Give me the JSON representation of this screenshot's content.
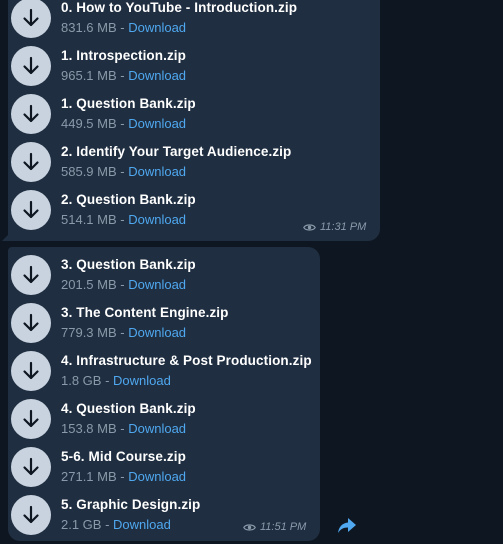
{
  "colors": {
    "background": "#0e1621",
    "bubble": "#1f2e40",
    "download_link": "#4fa8f0",
    "file_name": "#ffffff",
    "meta_text": "#8a9aaa",
    "icon_circle": "#c9d3df"
  },
  "messages": [
    {
      "files": [
        {
          "name": "0. How to YouTube - Introduction.zip",
          "size": "831.6 MB",
          "separator": " - ",
          "action": "Download",
          "icon": "download-arrow-icon"
        },
        {
          "name": "1. Introspection.zip",
          "size": "965.1 MB",
          "separator": " - ",
          "action": "Download",
          "icon": "download-arrow-icon"
        },
        {
          "name": "1. Question Bank.zip",
          "size": "449.5 MB",
          "separator": " - ",
          "action": "Download",
          "icon": "download-arrow-icon"
        },
        {
          "name": "2. Identify Your Target Audience.zip",
          "size": "585.9 MB",
          "separator": " - ",
          "action": "Download",
          "icon": "download-arrow-icon"
        },
        {
          "name": "2. Question Bank.zip",
          "size": "514.1 MB",
          "separator": " - ",
          "action": "Download",
          "icon": "download-arrow-icon"
        }
      ],
      "views_icon": "eye-icon",
      "time": "11:31 PM"
    },
    {
      "files": [
        {
          "name": "3. Question Bank.zip",
          "size": "201.5 MB",
          "separator": " - ",
          "action": "Download",
          "icon": "download-arrow-icon"
        },
        {
          "name": "3. The Content Engine.zip",
          "size": "779.3 MB",
          "separator": " - ",
          "action": "Download",
          "icon": "download-arrow-icon"
        },
        {
          "name": "4. Infrastructure & Post Production.zip",
          "size": "1.8 GB",
          "separator": " - ",
          "action": "Download",
          "icon": "download-arrow-icon"
        },
        {
          "name": "4. Question Bank.zip",
          "size": "153.8 MB",
          "separator": " - ",
          "action": "Download",
          "icon": "download-arrow-icon"
        },
        {
          "name": "5-6. Mid Course.zip",
          "size": "271.1 MB",
          "separator": " - ",
          "action": "Download",
          "icon": "download-arrow-icon"
        },
        {
          "name": "5. Graphic Design.zip",
          "size": "2.1 GB",
          "separator": " - ",
          "action": "Download",
          "icon": "download-arrow-icon"
        }
      ],
      "views_icon": "eye-icon",
      "time": "11:51 PM",
      "share_icon": "forward-arrow-icon"
    }
  ]
}
